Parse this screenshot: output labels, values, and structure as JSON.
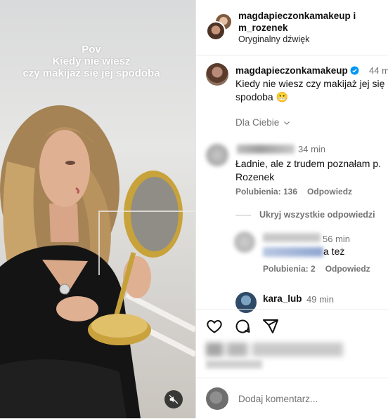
{
  "video": {
    "overlay_lines": [
      "Pov",
      "Kiedy nie wiesz",
      "czy makijaż się jej spodoba"
    ]
  },
  "header": {
    "username_line1": "magdapieczonkamakeup i",
    "username_line2": "m_rozenek",
    "audio": "Oryginalny dźwięk"
  },
  "caption": {
    "username": "magdapieczonkamakeup",
    "time": "44 m",
    "text": "Kiedy nie wiesz czy makijaż jej się spodoba 😬"
  },
  "filter": {
    "label": "Dla Ciebie"
  },
  "comments": [
    {
      "time": "34 min",
      "text": "Ładnie, ale z trudem poznałam p. Rozenek",
      "likes": "Polubienia: 136",
      "reply": "Odpowiedz"
    }
  ],
  "hide_replies": "Ukryj wszystkie odpowiedzi",
  "replies": [
    {
      "time": "56 min",
      "text_visible": "a też",
      "likes": "Polubienia: 2",
      "reply": "Odpowiedz"
    }
  ],
  "next_comment": {
    "username": "kara_lub",
    "time": "49 min"
  },
  "add_comment": {
    "placeholder": "Dodaj komentarz..."
  },
  "colors": {
    "verified": "#0095f6",
    "muted_text": "#737373",
    "border": "#ececec"
  }
}
